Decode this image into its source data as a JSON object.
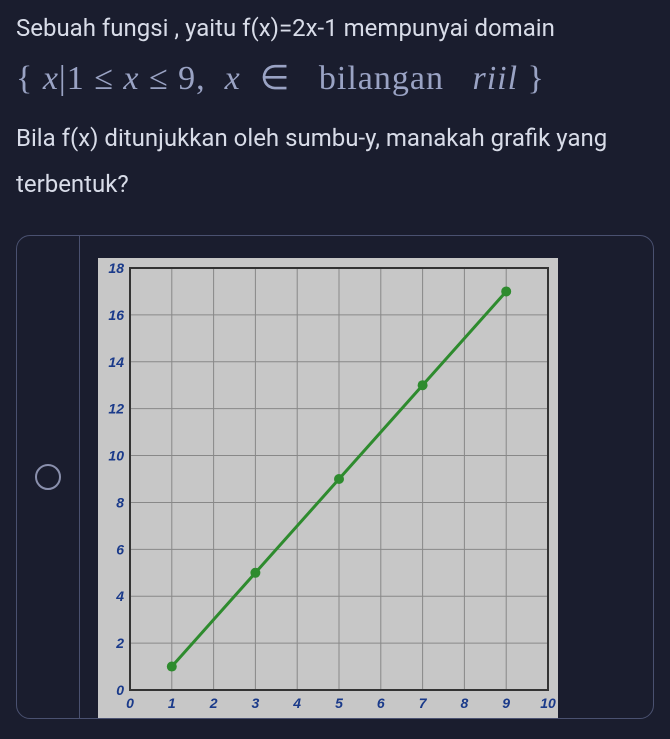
{
  "question": {
    "line1": "Sebuah fungsi , yaitu f(x)=2x-1 mempunyai domain",
    "domain_expr": {
      "open": "{",
      "var1": "x",
      "bar": "|",
      "lhs": "1",
      "le1": "≤",
      "var2": "x",
      "le2": "≤",
      "rhs": "9,",
      "var3": "x",
      "in": "∈",
      "set": "bilangan",
      "riil": "riil",
      "close": "}"
    },
    "line2": "Bila f(x) ditunjukkan oleh sumbu-y, manakah grafik yang terbentuk?"
  },
  "option": {
    "selected": false
  },
  "chart_data": {
    "type": "line",
    "xlabel": "",
    "ylabel": "",
    "xlim": [
      0,
      10
    ],
    "ylim": [
      0,
      18
    ],
    "x_ticks": [
      0,
      1,
      2,
      3,
      4,
      5,
      6,
      7,
      8,
      9,
      10
    ],
    "y_ticks": [
      0,
      2,
      4,
      6,
      8,
      10,
      12,
      14,
      16,
      18
    ],
    "series": [
      {
        "name": "f(x)=2x-1",
        "x": [
          1,
          2,
          3,
          4,
          5,
          6,
          7,
          8,
          9
        ],
        "y": [
          1,
          3,
          5,
          7,
          9,
          11,
          13,
          15,
          17
        ],
        "markers_x": [
          1,
          3,
          5,
          7,
          9
        ],
        "markers_y": [
          1,
          5,
          9,
          13,
          17
        ]
      }
    ]
  }
}
